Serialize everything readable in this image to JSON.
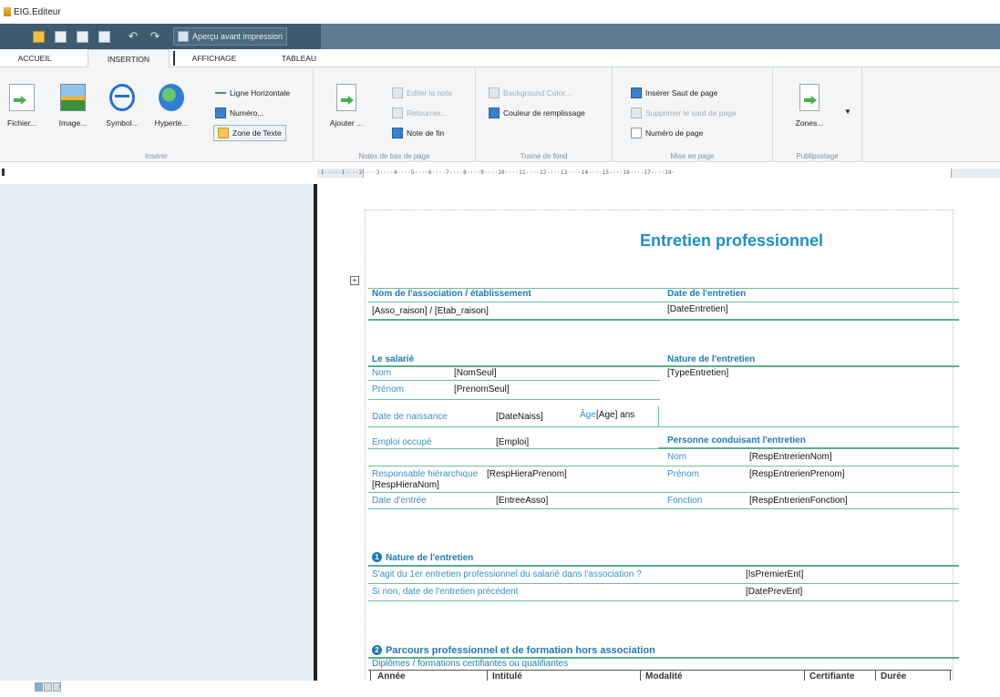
{
  "window": {
    "title": "EIG.Editeur"
  },
  "quick_access": {
    "print_preview_label": "Aperçu avant impression"
  },
  "tabs": [
    "ACCUEIL",
    "INSERTION",
    "AFFICHAGE",
    "TABLEAU"
  ],
  "active_tab": "INSERTION",
  "ribbon": {
    "inserer": {
      "label": "Insérer",
      "fichier": "Fichier...",
      "image": "Image...",
      "symbol": "Symbol...",
      "hypertexte": "Hyperte...",
      "ligne": "Ligne Horizontale",
      "numero": "Numéro...",
      "zone_texte": "Zone de Texte"
    },
    "notes": {
      "label": "Notes de bas de page",
      "ajouter": "Ajouter ...",
      "editer": "Editer la note",
      "retourner": "Retourner...",
      "note_fin": "Note de fin"
    },
    "trame": {
      "label": "Trame de fond",
      "background": "Background Color...",
      "couleur": "Couleur de remplissage"
    },
    "mise_en_page": {
      "label": "Mise en page",
      "inserer_saut": "Insérer Saut de page",
      "supprimer_saut": "Supprimer le saut de page",
      "numero_page": "Numéro de page"
    },
    "publipostage": {
      "label": "Publipostage",
      "zones": "Zones..."
    }
  },
  "ruler": {
    "text": "·1·····1····2····3····4····5····6····7····8····9····10····11····12····13····14····15····16····17····19·"
  },
  "document": {
    "title": "Entretien professionnel",
    "assoc_header": "Nom de l'association / établissement",
    "date_header": "Date de l'entretien",
    "assoc_value": "[Asso_raison] / [Etab_raison]",
    "date_value": "[DateEntretien]",
    "salarie_header": "Le salarié",
    "nature_header": "Nature de l'entretien",
    "nom_label": "Nom",
    "nom_value": "[NomSeul]",
    "type_value": "[TypeEntretien]",
    "prenom_label": "Prénom",
    "prenom_value": "[PrenomSeul]",
    "naissance_label": "Date de naissance",
    "naissance_value": "[DateNaiss]",
    "age_label": "Âge",
    "age_value": "[Age] ans",
    "emploi_label": "Emploi occupé",
    "emploi_value": "[Emploi]",
    "conduisant_header": "Personne conduisant l'entretien",
    "resp_nom_label": "Nom",
    "resp_nom_value": "[RespEntrerienNom]",
    "resp_hier_label": "Responsable hiérarchique",
    "resp_hier_value1": "[RespHieraPrenom]",
    "resp_hier_value2": "[RespHieraNom]",
    "resp_prenom_label": "Prénom",
    "resp_prenom_value": "[RespEntrerienPrenom]",
    "entree_label": "Date d'entrée",
    "entree_value": "[EntreeAsso]",
    "fonction_label": "Fonction",
    "fonction_value": "[RespEntrerienFonction]",
    "section1_num": "1",
    "section1_title": "Nature de l'entretien",
    "q1": "S'agit du 1er entretien professionnel du salarié dans l'association ?",
    "q1_value": "[IsPremierEnt]",
    "q2": "Si non, date de l'entretien précédent",
    "q2_value": "[DatePrevEnt]",
    "section2_num": "2",
    "section2_title": "Parcours professionnel et de formation hors association",
    "diplomes": "Diplômes / formations certifiantes ou qualifiantes",
    "table_headers": [
      "Année",
      "Intitulé",
      "Modalité",
      "Certifiante",
      "Durée"
    ]
  },
  "colors": {
    "accent": "#1f8fc7",
    "toolbar": "#3d5a70",
    "rule": "#6fbf98"
  }
}
